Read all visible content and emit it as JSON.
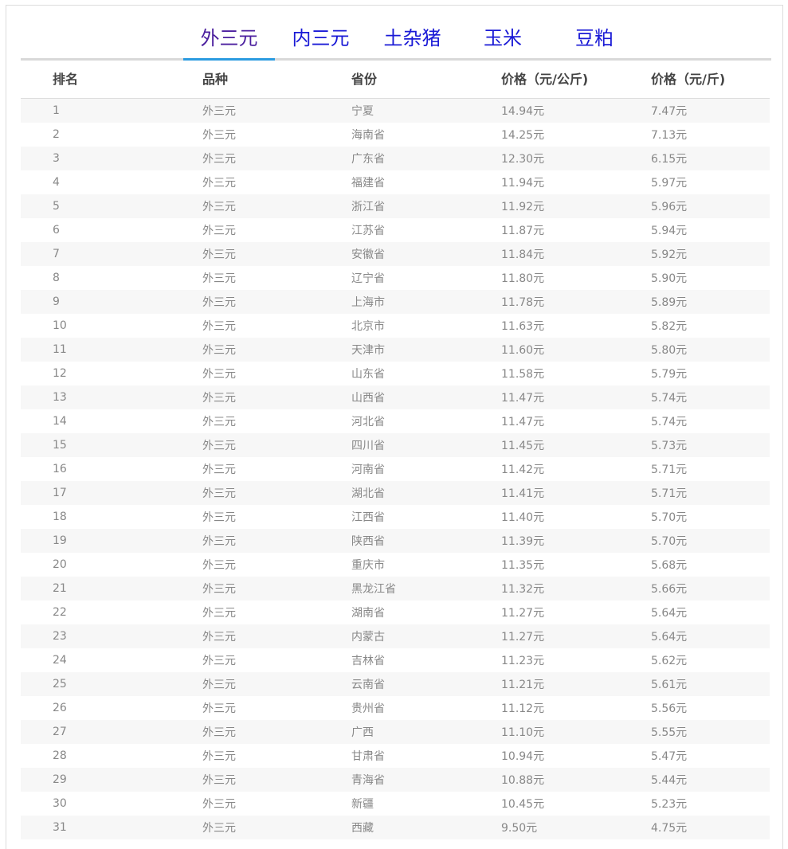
{
  "tabs": [
    {
      "label": "外三元",
      "active": true
    },
    {
      "label": "内三元",
      "active": false
    },
    {
      "label": "土杂猪",
      "active": false
    },
    {
      "label": "玉米",
      "active": false
    },
    {
      "label": "豆粕",
      "active": false
    }
  ],
  "table": {
    "headers": [
      "排名",
      "品种",
      "省份",
      "价格（元/公斤)",
      "价格（元/斤)"
    ],
    "rows": [
      [
        "1",
        "外三元",
        "宁夏",
        "14.94元",
        "7.47元"
      ],
      [
        "2",
        "外三元",
        "海南省",
        "14.25元",
        "7.13元"
      ],
      [
        "3",
        "外三元",
        "广东省",
        "12.30元",
        "6.15元"
      ],
      [
        "4",
        "外三元",
        "福建省",
        "11.94元",
        "5.97元"
      ],
      [
        "5",
        "外三元",
        "浙江省",
        "11.92元",
        "5.96元"
      ],
      [
        "6",
        "外三元",
        "江苏省",
        "11.87元",
        "5.94元"
      ],
      [
        "7",
        "外三元",
        "安徽省",
        "11.84元",
        "5.92元"
      ],
      [
        "8",
        "外三元",
        "辽宁省",
        "11.80元",
        "5.90元"
      ],
      [
        "9",
        "外三元",
        "上海市",
        "11.78元",
        "5.89元"
      ],
      [
        "10",
        "外三元",
        "北京市",
        "11.63元",
        "5.82元"
      ],
      [
        "11",
        "外三元",
        "天津市",
        "11.60元",
        "5.80元"
      ],
      [
        "12",
        "外三元",
        "山东省",
        "11.58元",
        "5.79元"
      ],
      [
        "13",
        "外三元",
        "山西省",
        "11.47元",
        "5.74元"
      ],
      [
        "14",
        "外三元",
        "河北省",
        "11.47元",
        "5.74元"
      ],
      [
        "15",
        "外三元",
        "四川省",
        "11.45元",
        "5.73元"
      ],
      [
        "16",
        "外三元",
        "河南省",
        "11.42元",
        "5.71元"
      ],
      [
        "17",
        "外三元",
        "湖北省",
        "11.41元",
        "5.71元"
      ],
      [
        "18",
        "外三元",
        "江西省",
        "11.40元",
        "5.70元"
      ],
      [
        "19",
        "外三元",
        "陕西省",
        "11.39元",
        "5.70元"
      ],
      [
        "20",
        "外三元",
        "重庆市",
        "11.35元",
        "5.68元"
      ],
      [
        "21",
        "外三元",
        "黑龙江省",
        "11.32元",
        "5.66元"
      ],
      [
        "22",
        "外三元",
        "湖南省",
        "11.27元",
        "5.64元"
      ],
      [
        "23",
        "外三元",
        "内蒙古",
        "11.27元",
        "5.64元"
      ],
      [
        "24",
        "外三元",
        "吉林省",
        "11.23元",
        "5.62元"
      ],
      [
        "25",
        "外三元",
        "云南省",
        "11.21元",
        "5.61元"
      ],
      [
        "26",
        "外三元",
        "贵州省",
        "11.12元",
        "5.56元"
      ],
      [
        "27",
        "外三元",
        "广西",
        "11.10元",
        "5.55元"
      ],
      [
        "28",
        "外三元",
        "甘肃省",
        "10.94元",
        "5.47元"
      ],
      [
        "29",
        "外三元",
        "青海省",
        "10.88元",
        "5.44元"
      ],
      [
        "30",
        "外三元",
        "新疆",
        "10.45元",
        "5.23元"
      ],
      [
        "31",
        "外三元",
        "西藏",
        "9.50元",
        "4.75元"
      ]
    ]
  },
  "colors": {
    "tab_text": "#1a1ad6",
    "tab_active_text": "#4b1f9e",
    "tab_active_underline": "#2b9be0",
    "row_stripe": "#f7f7f7"
  }
}
